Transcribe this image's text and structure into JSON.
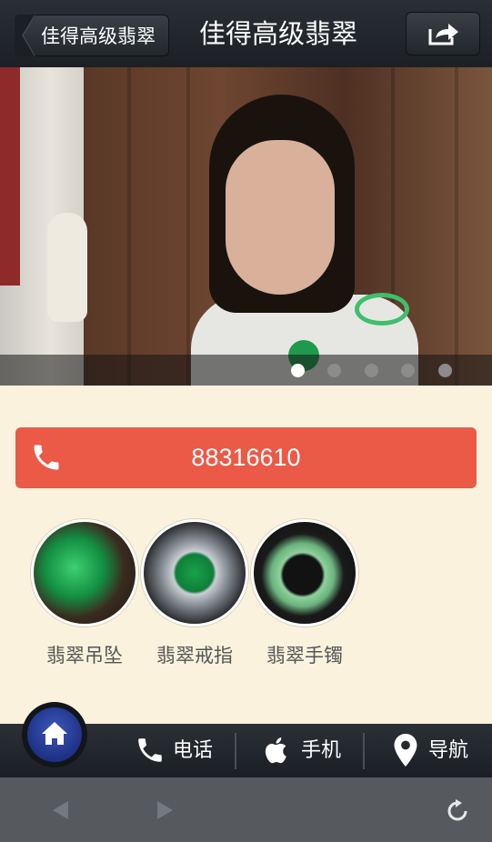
{
  "header": {
    "back_label": "佳得高级翡翠",
    "title": "佳得高级翡翠",
    "share_icon": "share-icon"
  },
  "banner": {
    "slide_count": 5,
    "active_slide": 1
  },
  "call": {
    "number": "88316610",
    "icon": "phone-icon",
    "color": "#ea5a46"
  },
  "categories": [
    {
      "label": "翡翠吊坠"
    },
    {
      "label": "翡翠戒指"
    },
    {
      "label": "翡翠手镯"
    }
  ],
  "nav": {
    "home_icon": "home-icon",
    "items": [
      {
        "label": "电话",
        "icon": "phone-icon"
      },
      {
        "label": "手机",
        "icon": "apple-icon"
      },
      {
        "label": "导航",
        "icon": "map-pin-icon"
      }
    ]
  },
  "browser": {
    "back_icon": "arrow-left-icon",
    "forward_icon": "arrow-right-icon",
    "refresh_icon": "refresh-icon"
  }
}
